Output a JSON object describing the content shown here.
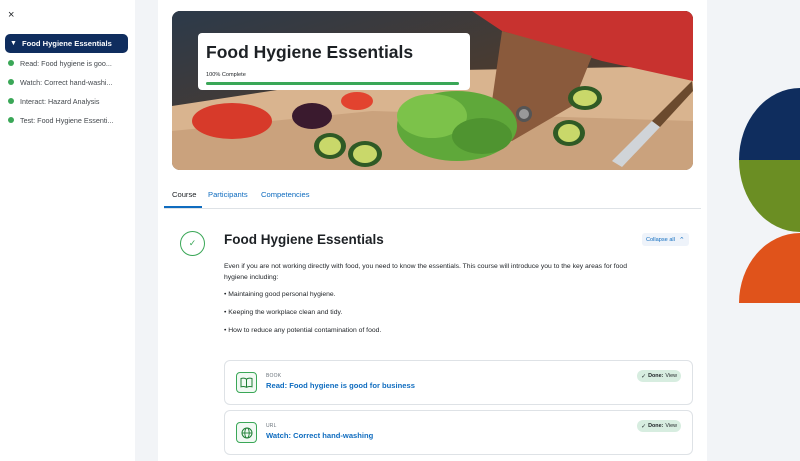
{
  "sidebar": {
    "close_glyph": "×",
    "active_item": "Food Hygiene Essentials",
    "items": [
      {
        "label": "Read: Food hygiene is goo..."
      },
      {
        "label": "Watch: Correct hand-washi..."
      },
      {
        "label": "Interact: Hazard Analysis"
      },
      {
        "label": "Test: Food Hygiene Essenti..."
      }
    ]
  },
  "hero": {
    "title": "Food Hygiene Essentials",
    "progress_label": "100% Complete",
    "progress_value": 1.0
  },
  "tabs": [
    {
      "label": "Course"
    },
    {
      "label": "Participants"
    },
    {
      "label": "Competencies"
    }
  ],
  "section": {
    "title": "Food Hygiene Essentials",
    "collapse_label": "Collapse all",
    "description": "Even if you are not working directly with food, you need to know the essentials. This course will introduce you to the key areas for food hygiene including:",
    "bullets": [
      "• Maintaining good personal hygiene.",
      "• Keeping the workplace clean and tidy.",
      "• How to reduce any potential contamination of food."
    ]
  },
  "activities": [
    {
      "type": "BOOK",
      "name": "Read: Food hygiene is good for business",
      "done": "Done:",
      "view": "View",
      "icon": "book-icon"
    },
    {
      "type": "URL",
      "name": "Watch: Correct hand-washing",
      "done": "Done:",
      "view": "View",
      "icon": "globe-icon"
    }
  ],
  "colors": {
    "brand_navy": "#0f2d5e",
    "accent_blue": "#0f6cbf",
    "success_green": "#3aa757",
    "deco_olive": "#6b8e23",
    "deco_orange": "#e0531b"
  }
}
